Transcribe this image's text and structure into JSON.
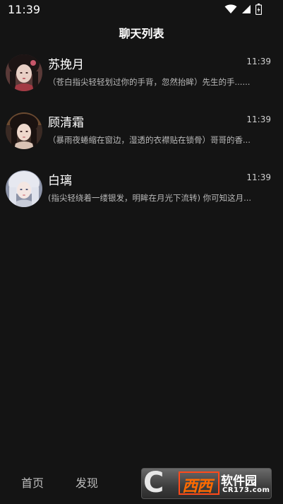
{
  "status_bar": {
    "time": "11:39",
    "icons": [
      "wifi-icon",
      "cellular-signal-icon",
      "battery-icon"
    ]
  },
  "header": {
    "title": "聊天列表"
  },
  "chats": [
    {
      "name": "苏挽月",
      "time": "11:39",
      "preview": "（苍白指尖轻轻划过你的手背，忽然抬眸）先生的手......"
    },
    {
      "name": "顾清霜",
      "time": "11:39",
      "preview": "（暴雨夜蜷缩在窗边，湿透的衣襟贴在锁骨）哥哥的香..."
    },
    {
      "name": "白璃",
      "time": "11:39",
      "preview": "(指尖轻绕着一缕银发，明眸在月光下流转) 你可知这月..."
    }
  ],
  "bottom_nav": {
    "items": [
      "首页",
      "发现"
    ]
  },
  "watermark": {
    "logo_letter": "C",
    "brand": "西西",
    "brand_suffix": "软件园",
    "url": "CR173.com"
  },
  "colors": {
    "background": "#141414",
    "text_primary": "#ffffff",
    "text_secondary": "#b9b9b9",
    "watermark_accent": "#ff6a00"
  }
}
